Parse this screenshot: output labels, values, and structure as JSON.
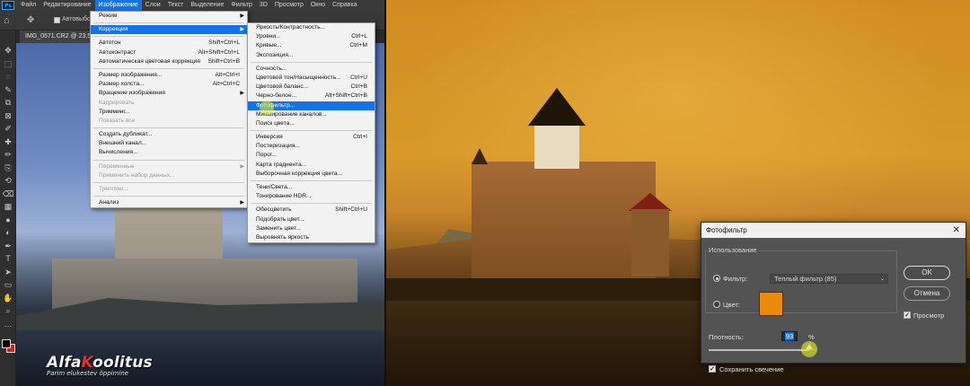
{
  "app": {
    "logo": "Ps",
    "menu": [
      "Файл",
      "Редактирование",
      "Изображение",
      "Слои",
      "Текст",
      "Выделение",
      "Фильтр",
      "3D",
      "Просмотр",
      "Окно",
      "Справка"
    ],
    "active_menu_index": 2,
    "options": {
      "auto_select_label": "Автовыбо"
    },
    "document_tab": "IMG_0571.CR2 @ 23,5% (",
    "icons": {
      "home": "home-icon",
      "move": "move-tool-icon",
      "tools": [
        "move-icon",
        "marquee-icon",
        "lasso-icon",
        "quick-select-icon",
        "crop-icon",
        "frame-icon",
        "eyedropper-icon",
        "healing-icon",
        "brush-icon",
        "clone-stamp-icon",
        "history-brush-icon",
        "eraser-icon",
        "gradient-icon",
        "blur-icon",
        "dodge-icon",
        "pen-icon",
        "type-icon",
        "path-select-icon",
        "shape-icon",
        "hand-icon",
        "zoom-icon",
        "more-icon"
      ]
    },
    "colors": {
      "foreground": "#000000",
      "background": "#d62020",
      "accent": "#1473e6"
    }
  },
  "image_menu": {
    "items": [
      {
        "label": "Режим",
        "shortcut": "",
        "submenu": true
      },
      {
        "sep": true
      },
      {
        "label": "Коррекция",
        "shortcut": "",
        "submenu": true,
        "highlight": true
      },
      {
        "sep": true
      },
      {
        "label": "Автотон",
        "shortcut": "Shift+Ctrl+L"
      },
      {
        "label": "Автоконтраст",
        "shortcut": "Alt+Shift+Ctrl+L"
      },
      {
        "label": "Автоматическая цветовая коррекция",
        "shortcut": "Shift+Ctrl+B"
      },
      {
        "sep": true
      },
      {
        "label": "Размер изображения...",
        "shortcut": "Alt+Ctrl+I"
      },
      {
        "label": "Размер холста...",
        "shortcut": "Alt+Ctrl+C"
      },
      {
        "label": "Вращение изображения",
        "shortcut": "",
        "submenu": true
      },
      {
        "label": "Кадрировать",
        "shortcut": "",
        "disabled": true
      },
      {
        "label": "Тримминг...",
        "shortcut": ""
      },
      {
        "label": "Показать все",
        "shortcut": "",
        "disabled": true
      },
      {
        "sep": true
      },
      {
        "label": "Создать дубликат...",
        "shortcut": ""
      },
      {
        "label": "Внешний канал...",
        "shortcut": ""
      },
      {
        "label": "Вычисления...",
        "shortcut": ""
      },
      {
        "sep": true
      },
      {
        "label": "Переменные",
        "shortcut": "",
        "submenu": true,
        "disabled": true
      },
      {
        "label": "Применить набор данных...",
        "shortcut": "",
        "disabled": true
      },
      {
        "sep": true
      },
      {
        "label": "Треппинг...",
        "shortcut": "",
        "disabled": true
      },
      {
        "sep": true
      },
      {
        "label": "Анализ",
        "shortcut": "",
        "submenu": true
      }
    ]
  },
  "adjust_menu": {
    "items": [
      {
        "label": "Яркость/Контрастность...",
        "shortcut": ""
      },
      {
        "label": "Уровни...",
        "shortcut": "Ctrl+L"
      },
      {
        "label": "Кривые...",
        "shortcut": "Ctrl+M"
      },
      {
        "label": "Экспозиция...",
        "shortcut": ""
      },
      {
        "sep": true
      },
      {
        "label": "Сочность...",
        "shortcut": ""
      },
      {
        "label": "Цветовой тон/Насыщенность...",
        "shortcut": "Ctrl+U"
      },
      {
        "label": "Цветовой баланс...",
        "shortcut": "Ctrl+B"
      },
      {
        "label": "Черно-белое...",
        "shortcut": "Alt+Shift+Ctrl+B"
      },
      {
        "label": "Фотофильтр...",
        "shortcut": "",
        "highlight": true
      },
      {
        "label": "Микширование каналов...",
        "shortcut": ""
      },
      {
        "label": "Поиск цвета...",
        "shortcut": ""
      },
      {
        "sep": true
      },
      {
        "label": "Инверсия",
        "shortcut": "Ctrl+I"
      },
      {
        "label": "Постеризация...",
        "shortcut": ""
      },
      {
        "label": "Порог...",
        "shortcut": ""
      },
      {
        "label": "Карта градиента...",
        "shortcut": ""
      },
      {
        "label": "Выборочная коррекция цвета...",
        "shortcut": ""
      },
      {
        "sep": true
      },
      {
        "label": "Тени/Света...",
        "shortcut": ""
      },
      {
        "label": "Тонирование HDR...",
        "shortcut": ""
      },
      {
        "sep": true
      },
      {
        "label": "Обесцветить",
        "shortcut": "Shift+Ctrl+U"
      },
      {
        "label": "Подобрать цвет...",
        "shortcut": ""
      },
      {
        "label": "Заменить цвет...",
        "shortcut": ""
      },
      {
        "label": "Выровнять яркость",
        "shortcut": ""
      }
    ]
  },
  "watermark": {
    "brand_white": "Alfa",
    "brand_red": "K",
    "brand_rest": "oolitus",
    "subtitle": "Parim elukestev õppimine"
  },
  "dialog": {
    "title": "Фотофильтр",
    "close_icon": "close-icon",
    "group_label": "Использование",
    "filter_label": "Фильтр:",
    "filter_value": "Теплый фильтр (85)",
    "color_label": "Цвет:",
    "color_value": "#ec8a0b",
    "ok_label": "OK",
    "cancel_label": "Отмена",
    "preview_label": "Просмотр",
    "preview_checked": true,
    "density_label": "Плотность:",
    "density_value": "93",
    "density_unit": "%",
    "density_fraction": 0.93,
    "preserve_label": "Сохранить свечение",
    "preserve_checked": true,
    "filter_selected": true
  }
}
